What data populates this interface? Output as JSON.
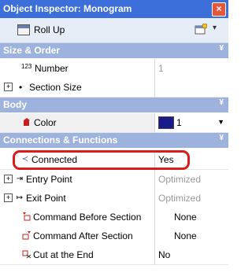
{
  "window": {
    "title": "Object Inspector: Monogram"
  },
  "toolbar": {
    "rollup_label": "Roll Up"
  },
  "sections": {
    "size_order": "Size & Order",
    "body": "Body",
    "connections": "Connections & Functions"
  },
  "rows": {
    "number": {
      "label": "Number",
      "prefix": "123",
      "value": "1"
    },
    "section_size": {
      "label": "Section Size"
    },
    "color": {
      "label": "Color",
      "value": "1"
    },
    "connected": {
      "label": "Connected",
      "value": "Yes"
    },
    "entry_point": {
      "label": "Entry Point",
      "value": "Optimized"
    },
    "exit_point": {
      "label": "Exit Point",
      "value": "Optimized"
    },
    "cmd_before": {
      "label": "Command Before Section",
      "value": "None"
    },
    "cmd_after": {
      "label": "Command After Section",
      "value": "None"
    },
    "cut_end": {
      "label": "Cut at the End",
      "value": "No"
    }
  },
  "colors": {
    "title_bar": "#3c6fd9",
    "section_header": "#9db2dc",
    "highlight_ring": "#d81b1b",
    "swatch": "#1a1a8a"
  },
  "icons": {
    "close": "close-icon",
    "rollup": "rollup-icon",
    "properties": "properties-icon",
    "connected": "connector-icon",
    "entry": "entry-point-icon",
    "exit": "exit-point-icon",
    "before": "command-before-icon",
    "after": "command-after-icon",
    "cut": "cut-icon"
  }
}
